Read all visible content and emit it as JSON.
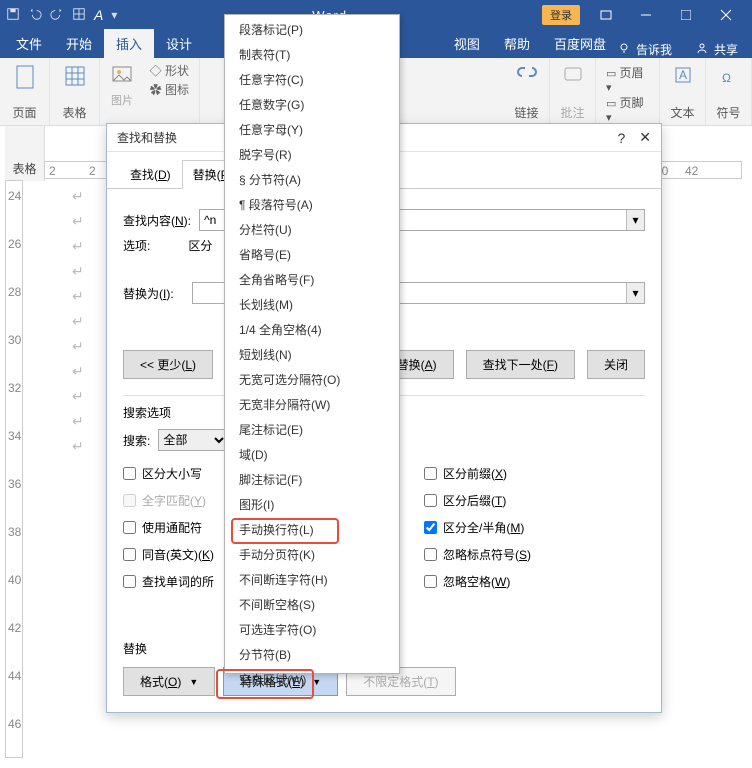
{
  "app": {
    "title": "Word"
  },
  "titlebar": {
    "login": "登录"
  },
  "tabs": {
    "file": "文件",
    "home": "开始",
    "insert": "插入",
    "design": "设计",
    "view": "视图",
    "help": "帮助",
    "baidu": "百度网盘",
    "tellme": "告诉我",
    "share": "共享"
  },
  "ribbon": {
    "page": "页面",
    "table": "表格",
    "table2": "表格",
    "pictures": "图片",
    "shapes": "形状",
    "icons": "图标",
    "link": "链接",
    "comment": "批注",
    "header": "页眉",
    "footer": "页脚",
    "text": "文本",
    "symbol": "符号"
  },
  "rulerH": [
    "2",
    "",
    "2",
    "",
    "",
    "",
    "",
    "",
    "",
    "",
    "",
    "",
    "",
    "",
    "",
    "40",
    "42"
  ],
  "rulerV": [
    "24",
    "26",
    "28",
    "30",
    "32",
    "34",
    "36",
    "38",
    "40",
    "42",
    "44",
    "46"
  ],
  "dialog": {
    "title": "查找和替换",
    "tabs": {
      "find": "查找(D)",
      "replace": "替换(P)"
    },
    "findLabel": "查找内容(N):",
    "findValue": "^n",
    "optionsLabel": "选项:",
    "optionsValue": "区分",
    "replaceLabel": "替换为(I):",
    "less": "<< 更少(L)",
    "replaceAll": "替换(A)",
    "next": "查找下一处(F)",
    "close": "关闭",
    "searchOptions": "搜索选项",
    "searchLabel": "搜索:",
    "searchValue": "全部",
    "chk": {
      "case": "区分大小写",
      "whole": "全字匹配(Y)",
      "wildcard": "使用通配符",
      "homonym": "同音(英文)(K)",
      "forms": "查找单词的所",
      "prefix": "区分前缀(X)",
      "suffix": "区分后缀(T)",
      "fullhalf": "区分全/半角(M)",
      "punct": "忽略标点符号(S)",
      "space": "忽略空格(W)"
    },
    "replaceSection": "替换",
    "format": "格式(O)",
    "special": "特殊格式(E)",
    "noformat": "不限定格式(T)"
  },
  "menu": {
    "items": [
      "段落标记(P)",
      "制表符(T)",
      "任意字符(C)",
      "任意数字(G)",
      "任意字母(Y)",
      "脱字号(R)",
      "§ 分节符(A)",
      "¶ 段落符号(A)",
      "分栏符(U)",
      "省略号(E)",
      "全角省略号(F)",
      "长划线(M)",
      "1/4 全角空格(4)",
      "短划线(N)",
      "无宽可选分隔符(O)",
      "无宽非分隔符(W)",
      "尾注标记(E)",
      "域(D)",
      "脚注标记(F)",
      "图形(I)",
      "手动换行符(L)",
      "手动分页符(K)",
      "不间断连字符(H)",
      "不间断空格(S)",
      "可选连字符(O)",
      "分节符(B)",
      "空白区域(W)"
    ]
  }
}
